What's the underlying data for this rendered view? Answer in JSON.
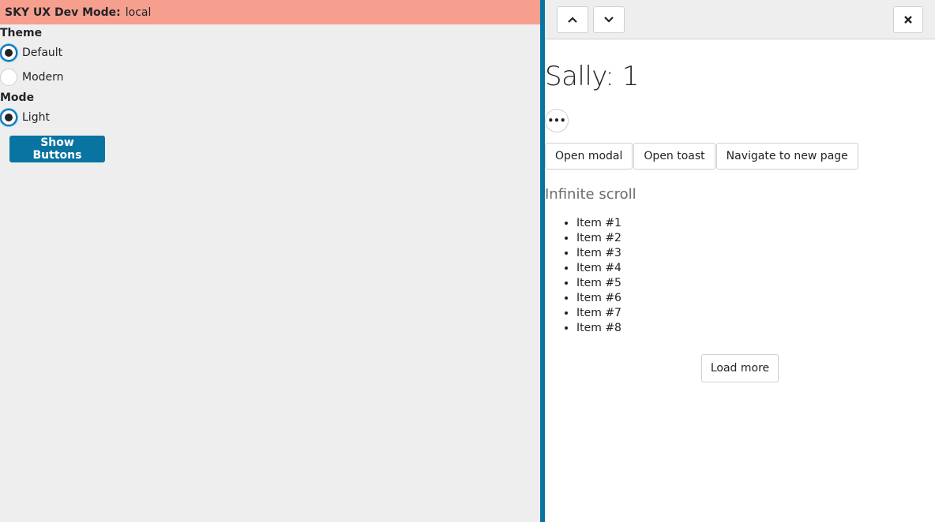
{
  "devbar": {
    "label": "SKY UX Dev Mode:",
    "value": "local"
  },
  "theme": {
    "label": "Theme",
    "options": [
      {
        "label": "Default",
        "checked": true
      },
      {
        "label": "Modern",
        "checked": false
      }
    ]
  },
  "mode": {
    "label": "Mode",
    "options": [
      {
        "label": "Light",
        "checked": true
      }
    ]
  },
  "show_buttons_label": "Show Buttons",
  "flyout": {
    "title": "Sally: 1",
    "ellipsis": "•••",
    "buttons": [
      "Open modal",
      "Open toast",
      "Navigate to new page"
    ],
    "subheading": "Infinite scroll",
    "items": [
      "Item #1",
      "Item #2",
      "Item #3",
      "Item #4",
      "Item #5",
      "Item #6",
      "Item #7",
      "Item #8"
    ],
    "load_more": "Load more"
  },
  "colors": {
    "devbar": "#f79f8f",
    "primary": "#0974a1",
    "radio_focus": "#4ec3e0"
  },
  "icons": {
    "up": "chevron-up-icon",
    "down": "chevron-down-icon",
    "close": "close-icon"
  }
}
